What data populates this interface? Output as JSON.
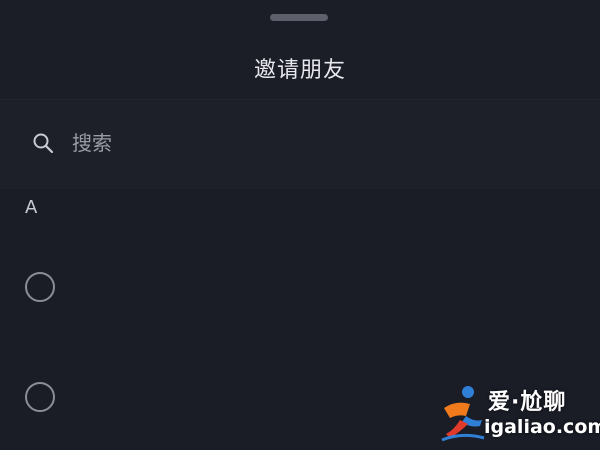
{
  "header": {
    "title": "邀请朋友"
  },
  "search": {
    "placeholder": "搜索",
    "value": ""
  },
  "sections": [
    {
      "letter": "A",
      "items": [
        {
          "name": "",
          "selected": false
        },
        {
          "name": "",
          "selected": false
        }
      ]
    }
  ],
  "watermark": {
    "top_text": "爱·尬聊",
    "bottom_text": "igaliao.com"
  },
  "colors": {
    "background": "#1a1c26",
    "text_primary": "#e8e9ee",
    "text_secondary": "#9a9ca5",
    "radio_border": "#8b8e98",
    "handle": "#5d606b"
  },
  "icons": {
    "search": "search-icon",
    "drag": "drag-handle",
    "radio": "radio-unchecked-icon"
  }
}
